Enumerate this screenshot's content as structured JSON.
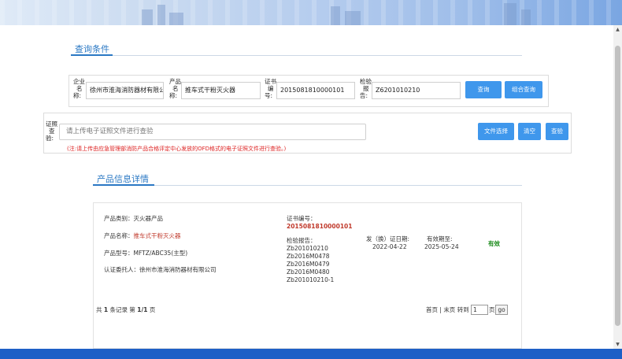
{
  "query_section": {
    "title": "查询条件"
  },
  "query": {
    "enterprise_label": [
      "企业",
      "名",
      "称:"
    ],
    "enterprise_value": "徐州市淮海消防器材有限公司",
    "product_label": [
      "产品",
      "名",
      "称:"
    ],
    "product_value": "推车式干粉灭火器",
    "cert_label": [
      "证书",
      "编",
      "号:"
    ],
    "cert_value": "2015081810000101",
    "report_label": [
      "检验",
      "报",
      "告:"
    ],
    "report_value": "Z6201010210",
    "search_button": "查询",
    "combo_button": "组合查询"
  },
  "cert_check": {
    "label": [
      "证照",
      "查",
      "验:"
    ],
    "placeholder": "请上传电子证照文件进行查验",
    "choose_button": "文件选择",
    "clear_button": "清空",
    "verify_button": "查验",
    "note": "(注:请上传由应急管理部消防产品合格评定中心发放的OFD格式的电子证照文件进行查验。)"
  },
  "detail_section": {
    "title": "产品信息详情"
  },
  "detail": {
    "category_label": "产品类别：",
    "category_value": "灭火器产品",
    "name_label": "产品名称：",
    "name_value": "推车式干粉灭火器",
    "model_label": "产品型号：",
    "model_value": "MFTZ/ABC35(主型)",
    "client_label": "认证委托人：",
    "client_value": "徐州市淮海消防器材有限公司",
    "cert_no_label": "证书编号：",
    "cert_no_value": "2015081810000101",
    "report_label": "检验报告：",
    "reports": [
      "Zb201010210",
      "Zb2016M0478",
      "Zb2016M0479",
      "Zb2016M0480",
      "Zb201010210-1"
    ],
    "issue_label": "发（换）证日期:",
    "issue_date": "2022-04-22",
    "expiry_label": "有效期至:",
    "expiry_date": "2025-05-24",
    "status": "有效"
  },
  "pagination": {
    "prefix": "共",
    "total": "1",
    "records_text": "条记录 第",
    "page": "1/1",
    "page_suffix": "页",
    "first": "首页",
    "sep": "|",
    "last": "末页",
    "goto_label": "转到",
    "goto_value": "1",
    "goto_suffix": "页",
    "go": "go"
  },
  "colors": {
    "accent": "#2a78c4",
    "button": "#3f97ec",
    "footer": "#1d5fc6",
    "alert": "#d22222",
    "valid": "#1a8a1a"
  }
}
